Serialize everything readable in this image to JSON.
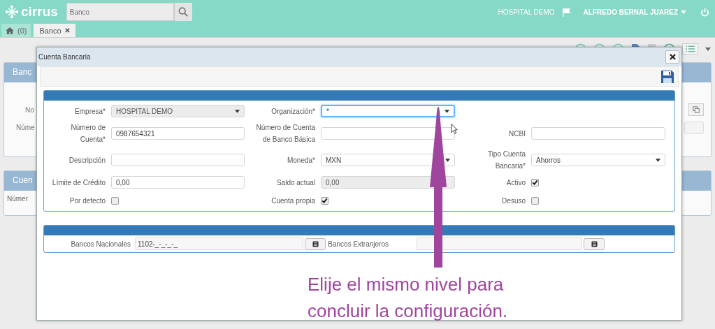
{
  "header": {
    "logo": "cirrus",
    "search": {
      "placeholder": "Banco"
    },
    "organization": "HOSPITAL DEMO",
    "user": "ALFREDO BERNAL JUAREZ"
  },
  "tabs": [
    {
      "label": "(0)",
      "kind": "home",
      "selected": false
    },
    {
      "label": "Banco",
      "kind": "document",
      "selected": true
    }
  ],
  "background": {
    "panel_1": {
      "title": "Banc",
      "labels": [
        "No",
        "Núme"
      ]
    },
    "panel_2": {
      "title": "Cuen",
      "column": "Númer"
    }
  },
  "dialog": {
    "title": "Cuenta Bancaria",
    "form_rows": [
      [
        {
          "label": "Empresa*",
          "kind": "select",
          "value": "HOSPITAL DEMO",
          "disabled": true,
          "focused": false
        },
        {
          "label": "Organización*",
          "kind": "select",
          "value": "*",
          "disabled": false,
          "focused": true
        }
      ],
      [
        {
          "label": "Número de Cuenta*",
          "kind": "input",
          "value": "0987654321",
          "disabled": false,
          "focused": false
        },
        {
          "label": "Número de Cuenta de Banco Básica",
          "kind": "input",
          "disabled": false,
          "focused": false
        },
        {
          "label": "NCBI",
          "kind": "input",
          "disabled": false,
          "focused": false
        }
      ],
      [
        {
          "label": "Descripción",
          "kind": "input",
          "disabled": false,
          "focused": false
        },
        {
          "label": "Moneda*",
          "kind": "select",
          "value": "MXN",
          "disabled": false,
          "focused": false
        },
        {
          "label": "Tipo Cuenta Bancaria*",
          "kind": "select",
          "value": "Ahorros",
          "disabled": false,
          "focused": false
        }
      ],
      [
        {
          "label": "Límite de Crédito",
          "kind": "input",
          "value": "0,00",
          "disabled": false,
          "focused": false
        },
        {
          "label": "Saldo actual",
          "kind": "input",
          "value": "0,00",
          "disabled": true,
          "focused": false
        },
        {
          "label": "Activo",
          "kind": "checkbox",
          "checked": true
        }
      ],
      [
        {
          "label": "Por defecto",
          "kind": "checkbox",
          "checked": false
        },
        {
          "label": "Cuenta propia",
          "kind": "checkbox",
          "checked": true
        },
        {
          "label": "Desuso",
          "kind": "checkbox",
          "checked": false
        }
      ]
    ],
    "lookups": [
      {
        "label": "Bancos Nacionales",
        "value": "1102-_-_-_-_"
      },
      {
        "label": "Bancos Extranjeros"
      }
    ]
  },
  "annotation": "Elije el mismo nivel para concluir la configuración."
}
